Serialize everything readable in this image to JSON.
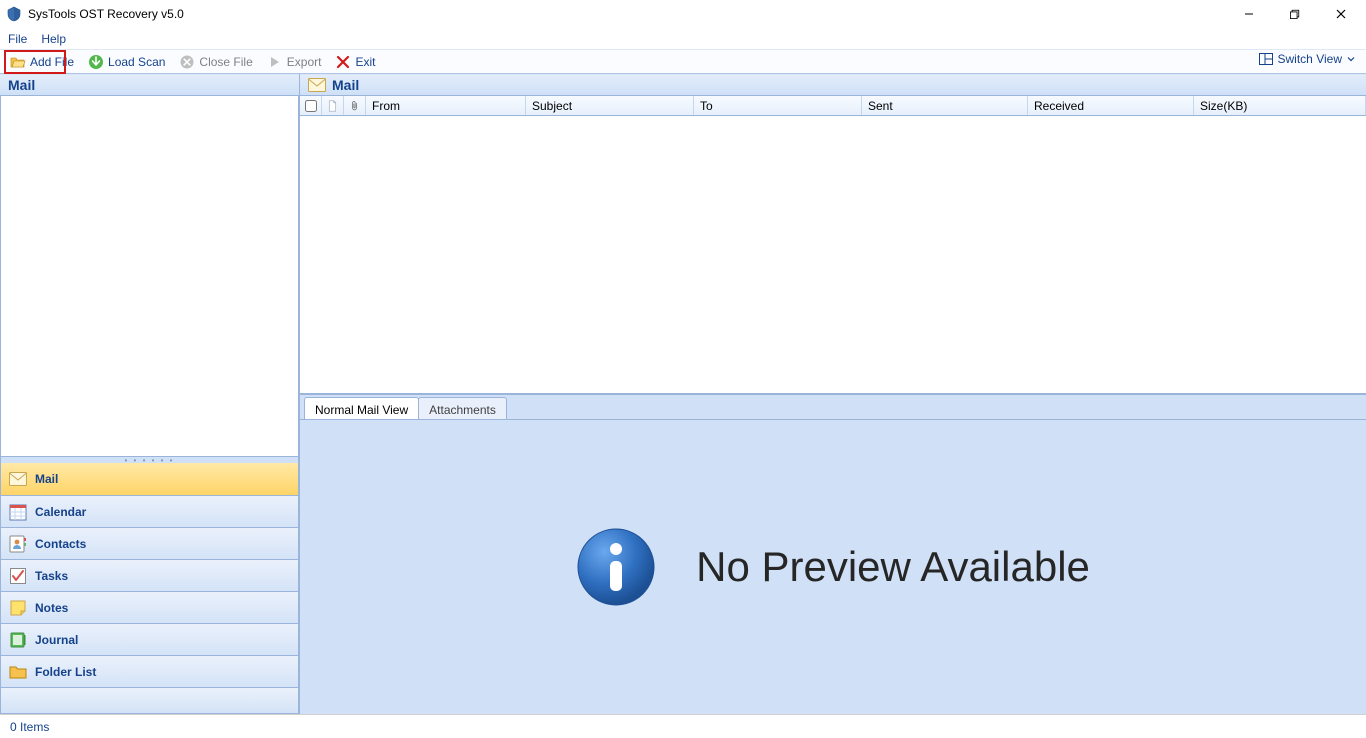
{
  "window": {
    "title": "SysTools OST Recovery v5.0"
  },
  "menubar": {
    "file": "File",
    "help": "Help"
  },
  "toolbar": {
    "add_file": "Add File",
    "load_scan": "Load Scan",
    "close_file": "Close File",
    "export": "Export",
    "exit": "Exit",
    "switch_view": "Switch View"
  },
  "left_panel": {
    "header": "Mail"
  },
  "nav": {
    "mail": "Mail",
    "calendar": "Calendar",
    "contacts": "Contacts",
    "tasks": "Tasks",
    "notes": "Notes",
    "journal": "Journal",
    "folder_list": "Folder List"
  },
  "mail_panel": {
    "header": "Mail"
  },
  "columns": {
    "from": "From",
    "subject": "Subject",
    "to": "To",
    "sent": "Sent",
    "received": "Received",
    "size": "Size(KB)"
  },
  "tabs": {
    "normal": "Normal Mail View",
    "attachments": "Attachments"
  },
  "preview": {
    "message": "No Preview Available"
  },
  "status": {
    "items": "0 Items"
  }
}
